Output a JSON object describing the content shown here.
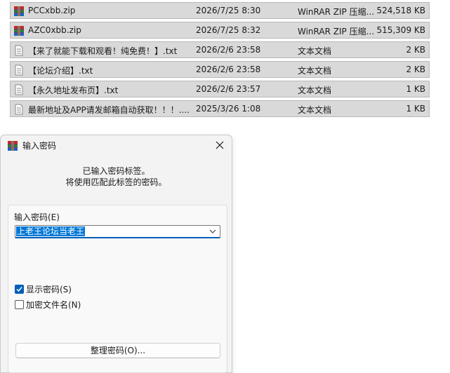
{
  "files": [
    {
      "name": "PCCxbb.zip",
      "date": "2026/7/25 8:30",
      "type": "WinRAR ZIP 压缩...",
      "size": "524,518 KB",
      "icon": "winrar-zip-icon"
    },
    {
      "name": "AZC0xbb.zip",
      "date": "2026/7/25 8:32",
      "type": "WinRAR ZIP 压缩...",
      "size": "515,309 KB",
      "icon": "winrar-zip-icon"
    },
    {
      "name": "【来了就能下载和观看！纯免费！】.txt",
      "date": "2026/2/6 23:58",
      "type": "文本文档",
      "size": "2 KB",
      "icon": "text-file-icon"
    },
    {
      "name": "【论坛介绍】.txt",
      "date": "2026/2/6 23:58",
      "type": "文本文档",
      "size": "2 KB",
      "icon": "text-file-icon"
    },
    {
      "name": "【永久地址发布页】.txt",
      "date": "2026/2/6 23:57",
      "type": "文本文档",
      "size": "1 KB",
      "icon": "text-file-icon"
    },
    {
      "name": "最新地址及APP请发邮箱自动获取！！！....",
      "date": "2025/3/26 1:08",
      "type": "文本文档",
      "size": "1 KB",
      "icon": "text-file-icon"
    }
  ],
  "dialog": {
    "title": "输入密码",
    "message_line1": "已输入密码标签。",
    "message_line2": "将使用匹配此标签的密码。",
    "password_label": "输入密码(E)",
    "password_value": "上老王论坛当老王",
    "show_password_label": "显示密码(S)",
    "show_password_checked": true,
    "encrypt_names_label": "加密文件名(N)",
    "encrypt_names_checked": false,
    "organize_button_label": "整理密码(O)..."
  },
  "colors": {
    "row_bg": "#d9d9d9",
    "accent": "#005fb8",
    "selection": "#0078d7"
  }
}
